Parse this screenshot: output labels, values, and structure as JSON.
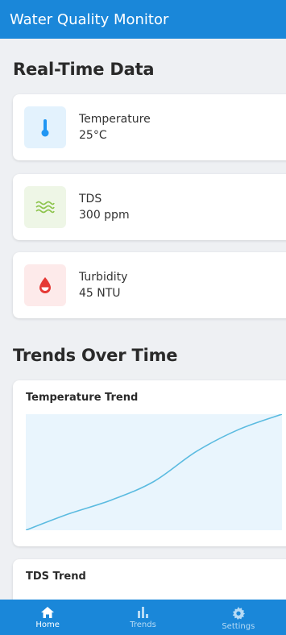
{
  "app": {
    "title": "Water Quality Monitor"
  },
  "sections": {
    "realtime_title": "Real-Time Data",
    "trends_title": "Trends Over Time"
  },
  "metrics": [
    {
      "label": "Temperature",
      "value": "25°C",
      "icon": "thermometer-icon",
      "color": "#2196f3",
      "bg": "#e3f2fd"
    },
    {
      "label": "TDS",
      "value": "300 ppm",
      "icon": "waves-icon",
      "color": "#8bc34a",
      "bg": "#eef6e6"
    },
    {
      "label": "Turbidity",
      "value": "45 NTU",
      "icon": "water-drop-icon",
      "color": "#e53935",
      "bg": "#fdeaea"
    }
  ],
  "trends": [
    {
      "title": "Temperature Trend"
    },
    {
      "title": "TDS Trend"
    }
  ],
  "chart_data": {
    "type": "line",
    "title": "Temperature Trend",
    "xlabel": "",
    "ylabel": "",
    "series": [
      {
        "values": [
          0,
          0.14,
          0.26,
          0.42,
          0.68,
          0.87,
          1.0
        ]
      }
    ],
    "grid": false,
    "line_color": "#5bbbe0"
  },
  "nav": [
    {
      "label": "Home",
      "icon": "home-icon",
      "active": true
    },
    {
      "label": "Trends",
      "icon": "bar-chart-icon",
      "active": false
    },
    {
      "label": "Settings",
      "icon": "gear-icon",
      "active": false
    }
  ],
  "colors": {
    "primary": "#1a87d9",
    "background": "#eef0f3",
    "chart_fill": "#e9f5fd"
  }
}
